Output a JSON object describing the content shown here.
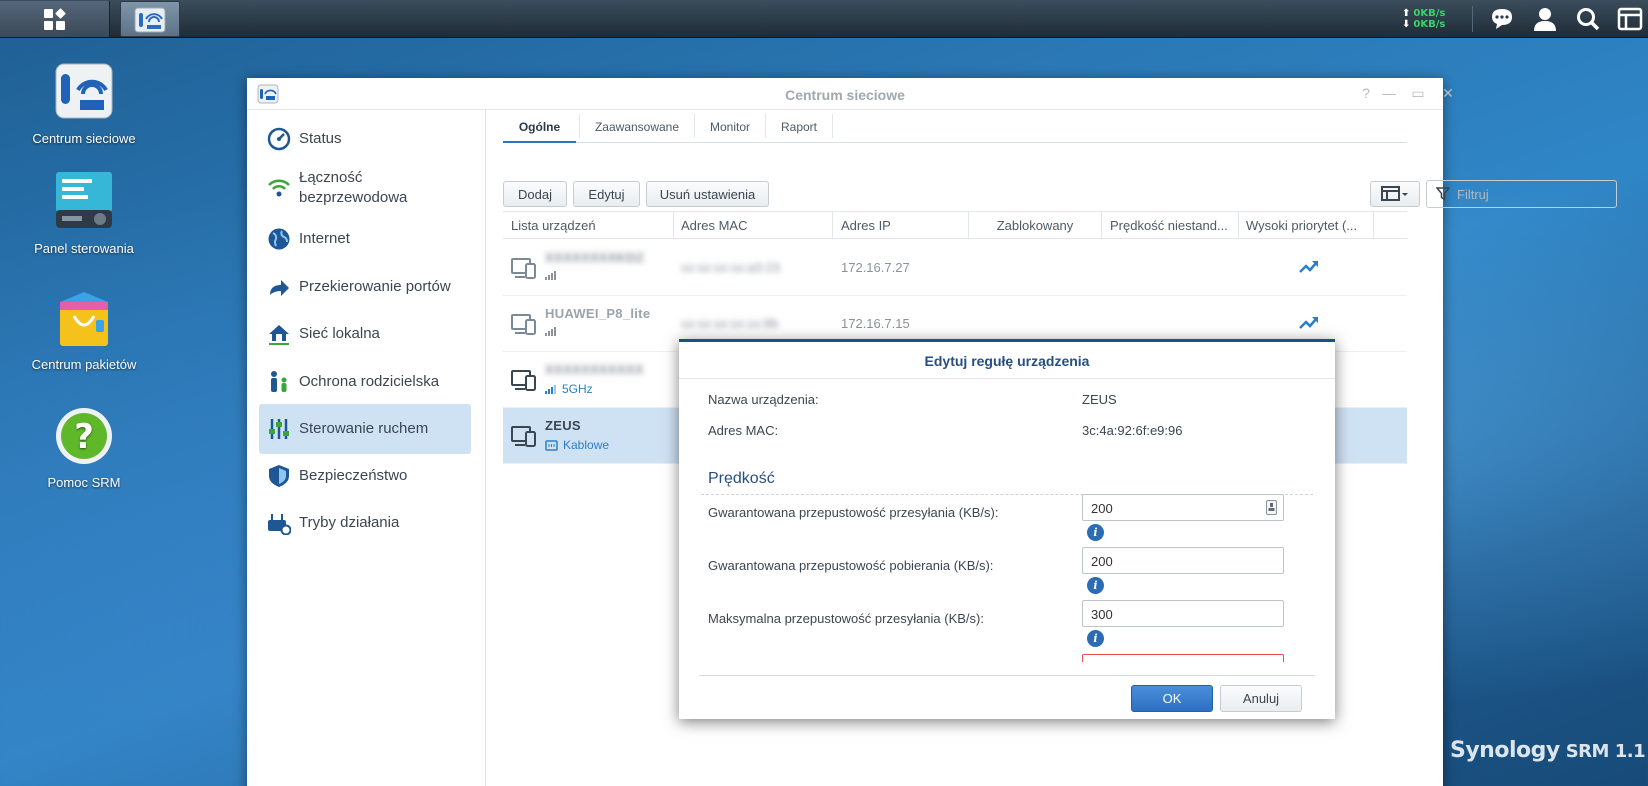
{
  "taskbar": {
    "upload_speed": "0KB/s",
    "download_speed": "0KB/s"
  },
  "desktop": {
    "icons": [
      {
        "label": "Centrum sieciowe"
      },
      {
        "label": "Panel sterowania"
      },
      {
        "label": "Centrum pakietów"
      },
      {
        "label": "Pomoc SRM"
      }
    ],
    "brand": "Synology",
    "product": "SRM 1.1"
  },
  "window": {
    "title": "Centrum sieciowe",
    "sidebar": [
      {
        "label": "Status",
        "icon": "gauge-icon"
      },
      {
        "label": "Łączność bezprzewodowa",
        "icon": "wifi-icon"
      },
      {
        "label": "Internet",
        "icon": "globe-icon"
      },
      {
        "label": "Przekierowanie portów",
        "icon": "forward-arrow-icon"
      },
      {
        "label": "Sieć lokalna",
        "icon": "home-network-icon"
      },
      {
        "label": "Ochrona rodzicielska",
        "icon": "family-icon"
      },
      {
        "label": "Sterowanie ruchem",
        "icon": "sliders-icon",
        "active": true
      },
      {
        "label": "Bezpieczeństwo",
        "icon": "shield-icon"
      },
      {
        "label": "Tryby działania",
        "icon": "router-gear-icon"
      }
    ],
    "tabs": [
      "Ogólne",
      "Zaawansowane",
      "Monitor",
      "Raport"
    ],
    "toolbar": {
      "add": "Dodaj",
      "edit": "Edytuj",
      "remove": "Usuń ustawienia",
      "filter_placeholder": "Filtruj"
    },
    "columns": [
      "Lista urządzeń",
      "Adres MAC",
      "Adres IP",
      "Zablokowany",
      "Prędkość niestand...",
      "Wysoki priorytet (..."
    ],
    "devices": [
      {
        "name": "XXXXXXXXKDZ",
        "sub": "",
        "mac": "xx:xx:xx:xx:a3:23",
        "ip": "172.16.7.27"
      },
      {
        "name": "HUAWEI_P8_lite",
        "sub": "",
        "mac": "xx:xx:xx:xx:xx:8b",
        "ip": "172.16.7.15"
      },
      {
        "name": "XXXXXXXXXXX",
        "sub": "5GHz",
        "mac": "",
        "ip": ""
      },
      {
        "name": "ZEUS",
        "sub": "Kablowe",
        "mac": "",
        "ip": ""
      }
    ]
  },
  "dialog": {
    "title": "Edytuj regułę urządzenia",
    "device_name_label": "Nazwa urządzenia:",
    "device_name": "ZEUS",
    "mac_label": "Adres MAC:",
    "mac": "3c:4a:92:6f:e9:96",
    "section": "Prędkość",
    "fields": [
      {
        "label": "Gwarantowana przepustowość przesyłania (KB/s):",
        "value": "200"
      },
      {
        "label": "Gwarantowana przepustowość pobierania (KB/s):",
        "value": "200"
      },
      {
        "label": "Maksymalna przepustowość przesyłania (KB/s):",
        "value": "300"
      }
    ],
    "ok": "OK",
    "cancel": "Anuluj"
  }
}
